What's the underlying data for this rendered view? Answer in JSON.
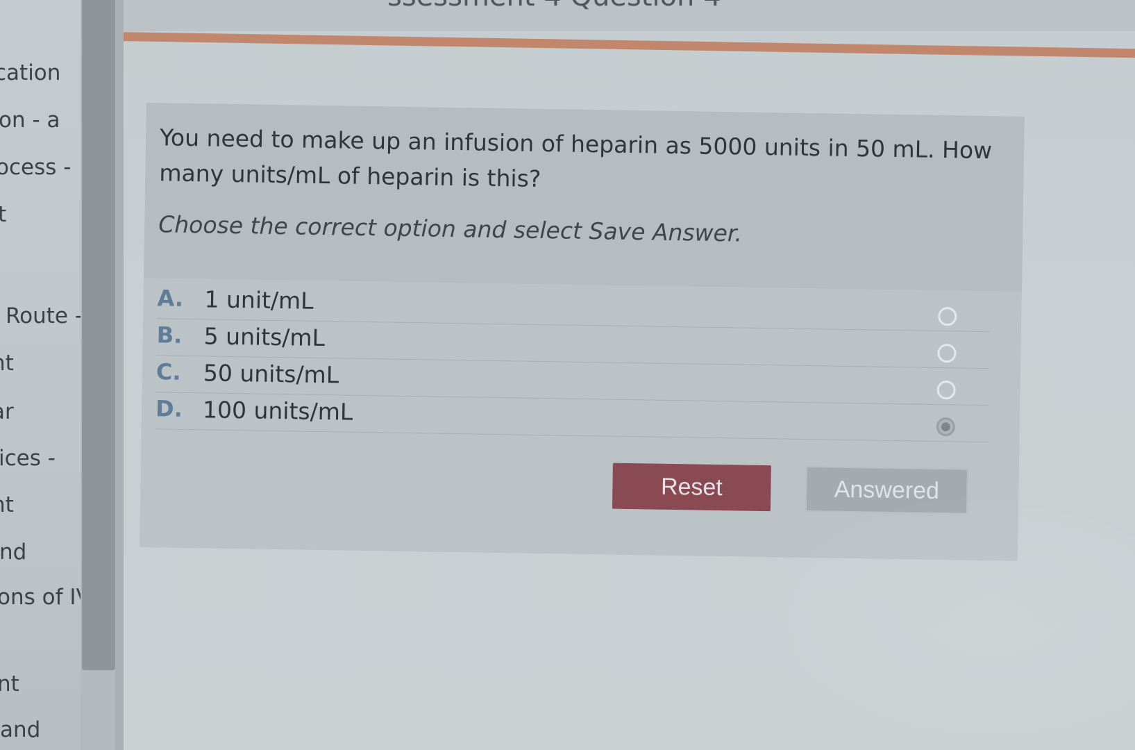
{
  "sidebar": {
    "items": [
      {
        "label": "cation"
      },
      {
        "label": "on - a"
      },
      {
        "label": "ocess -"
      },
      {
        "label": "t"
      },
      {
        "label": "Route -"
      },
      {
        "label": "nt"
      },
      {
        "label": "ar"
      },
      {
        "label": "ices -"
      },
      {
        "label": "nt"
      },
      {
        "label": "nd"
      },
      {
        "label": "ons of IV"
      },
      {
        "label": "nt"
      },
      {
        "label": "and"
      }
    ]
  },
  "header": {
    "title": "ssessment 4 Question 4"
  },
  "question": {
    "stem": "You need to make up an infusion of heparin as 5000 units in 50 mL. How many units/mL of heparin is this?",
    "instruction": "Choose the correct option and select Save Answer.",
    "options": [
      {
        "letter": "A.",
        "text": "1 unit/mL"
      },
      {
        "letter": "B.",
        "text": "5 units/mL"
      },
      {
        "letter": "C.",
        "text": "50 units/mL"
      },
      {
        "letter": "D.",
        "text": "100 units/mL"
      }
    ],
    "selected": "D."
  },
  "actions": {
    "reset_label": "Reset",
    "answered_label": "Answered"
  },
  "colors": {
    "accent_rule": "#c0876c",
    "reset_button": "#8a4a53",
    "option_letter": "#5f7c99"
  }
}
